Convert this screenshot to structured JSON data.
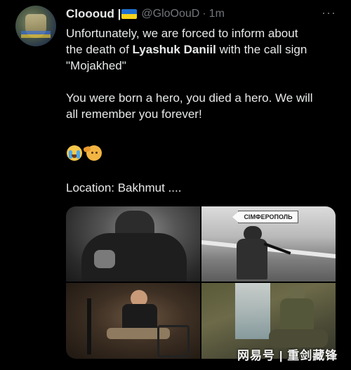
{
  "tweet": {
    "display_name": "Cloooud |",
    "handle": "@GloOouD",
    "separator": "·",
    "time": "1m",
    "more_icon": "···",
    "text": {
      "line1_pre": "Unfortunately, we are forced to inform about",
      "line2_pre": "the death of ",
      "line2_bold": "Lyashuk Daniil",
      "line2_post": " with the call sign",
      "line3": "\"Mojakhed\"",
      "line4": "You were born a hero, you died a hero. We will",
      "line5": "all remember you forever!",
      "location": "Location: Bakhmut ...."
    },
    "emojis": [
      "crying-face",
      "saluting-face"
    ],
    "photos": [
      {
        "name": "photo-soldier-closeup"
      },
      {
        "name": "photo-soldier-roadside",
        "sign_text": "СІМФЕРОПОЛЬ"
      },
      {
        "name": "photo-soldier-seated"
      },
      {
        "name": "photo-soldier-ruins"
      }
    ]
  },
  "watermark": "网易号 | 重剑藏锋",
  "colors": {
    "background": "#000000",
    "text": "#e7e9ea",
    "muted": "#71767b",
    "flag_blue": "#1f6fd0",
    "flag_yellow": "#f4d21c"
  }
}
